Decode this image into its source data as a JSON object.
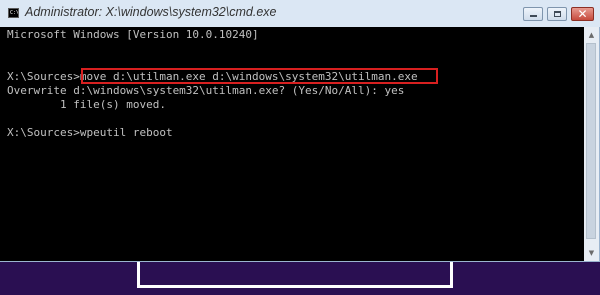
{
  "window": {
    "title": "Administrator: X:\\windows\\system32\\cmd.exe",
    "app_icon_text": "C:\\",
    "controls": {
      "minimize_icon": "minimize-icon",
      "maximize_icon": "maximize-icon",
      "close_icon": "close-icon",
      "close_glyph": "✕"
    }
  },
  "console": {
    "lines": [
      "Microsoft Windows [Version 10.0.10240]",
      "X:\\Sources>move d:\\utilman.exe d:\\windows\\system32\\utilman.exe",
      "Overwrite d:\\windows\\system32\\utilman.exe? (Yes/No/All): yes",
      "        1 file(s) moved.",
      "X:\\Sources>wpeutil reboot"
    ],
    "highlight_color": "#d82020",
    "text_color": "#c0c0c0",
    "background_color": "#000000"
  },
  "scrollbar": {
    "up_glyph": "▲",
    "down_glyph": "▼"
  },
  "desktop": {
    "background_color": "#2a0f52"
  }
}
